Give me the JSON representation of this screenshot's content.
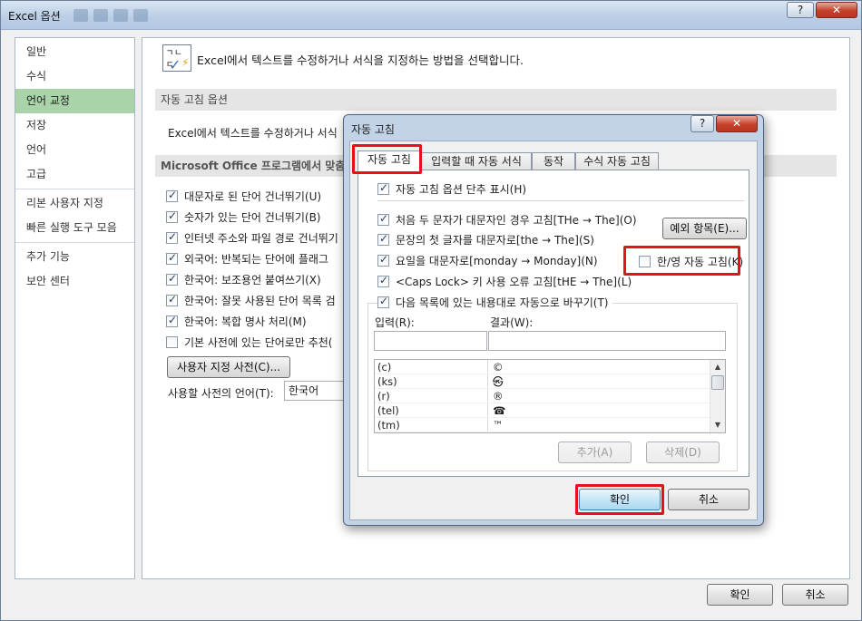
{
  "window": {
    "title": "Excel 옵션",
    "help": "?",
    "close": "✕"
  },
  "nav": {
    "items": [
      "일반",
      "수식",
      "언어 교정",
      "저장",
      "언어",
      "고급",
      "리본 사용자 지정",
      "빠른 실행 도구 모음",
      "추가 기능",
      "보안 센터"
    ],
    "selected": "언어 교정"
  },
  "content": {
    "header_icon": "abc-check-icon",
    "header_icon_text": "ㄱㄴㄷ",
    "header_text": "Excel에서 텍스트를 수정하거나 서식을 지정하는 방법을 선택합니다.",
    "section1": "자동 고침 옵션",
    "autocorrect_line": "Excel에서 텍스트를 수정하거나 서식",
    "section2": "Microsoft Office 프로그램에서 맞춤법",
    "options": [
      {
        "label": "대문자로 된 단어 건너뛰기(U)",
        "checked": true
      },
      {
        "label": "숫자가 있는 단어 건너뛰기(B)",
        "checked": true
      },
      {
        "label": "인터넷 주소와 파일 경로 건너뛰기",
        "checked": true
      },
      {
        "label": "외국어: 반복되는 단어에 플래그",
        "checked": true
      },
      {
        "label": "한국어: 보조용언 붙여쓰기(X)",
        "checked": true
      },
      {
        "label": "한국어: 잘못 사용된 단어 목록 검",
        "checked": true
      },
      {
        "label": "한국어: 복합 명사 처리(M)",
        "checked": true
      },
      {
        "label": "기본 사전에 있는 단어로만 추천(",
        "checked": false
      }
    ],
    "custom_dict_button": "사용자 지정 사전(C)...",
    "dict_lang_label": "사용할 사전의 언어(T):",
    "dict_lang_value": "한국어"
  },
  "footer": {
    "ok": "확인",
    "cancel": "취소"
  },
  "dialog": {
    "title": "자동 고침",
    "help": "?",
    "close": "✕",
    "tabs": [
      "자동 고침",
      "입력할 때 자동 서식",
      "동작",
      "수식 자동 고침"
    ],
    "active_tab": "자동 고침",
    "show_buttons": {
      "label": "자동 고침 옵션 단추 표시(H)",
      "checked": true
    },
    "rules": [
      {
        "label": "처음 두 문자가 대문자인 경우 고침[THe → The](O)",
        "checked": true
      },
      {
        "label": "문장의 첫 글자를 대문자로[the → The](S)",
        "checked": true
      },
      {
        "label": "요일을 대문자로[monday → Monday](N)",
        "checked": true
      },
      {
        "label": "<Caps Lock> 키 사용 오류 고침[tHE → The](L)",
        "checked": true
      },
      {
        "label": "다음 목록에 있는 내용대로 자동으로 바꾸기(T)",
        "checked": true
      }
    ],
    "exceptions_button": "예외 항목(E)...",
    "hanyoung": {
      "label": "한/영 자동 고침(K)",
      "checked": false
    },
    "input_label": "입력(R):",
    "result_label": "결과(W):",
    "list": [
      {
        "input": "(c)",
        "result": "©"
      },
      {
        "input": "(ks)",
        "result": "㉿"
      },
      {
        "input": "(r)",
        "result": "®"
      },
      {
        "input": "(tel)",
        "result": "☎"
      },
      {
        "input": "(tm)",
        "result": "™"
      }
    ],
    "add_button": "추가(A)",
    "delete_button": "삭제(D)",
    "ok": "확인",
    "cancel": "취소"
  }
}
